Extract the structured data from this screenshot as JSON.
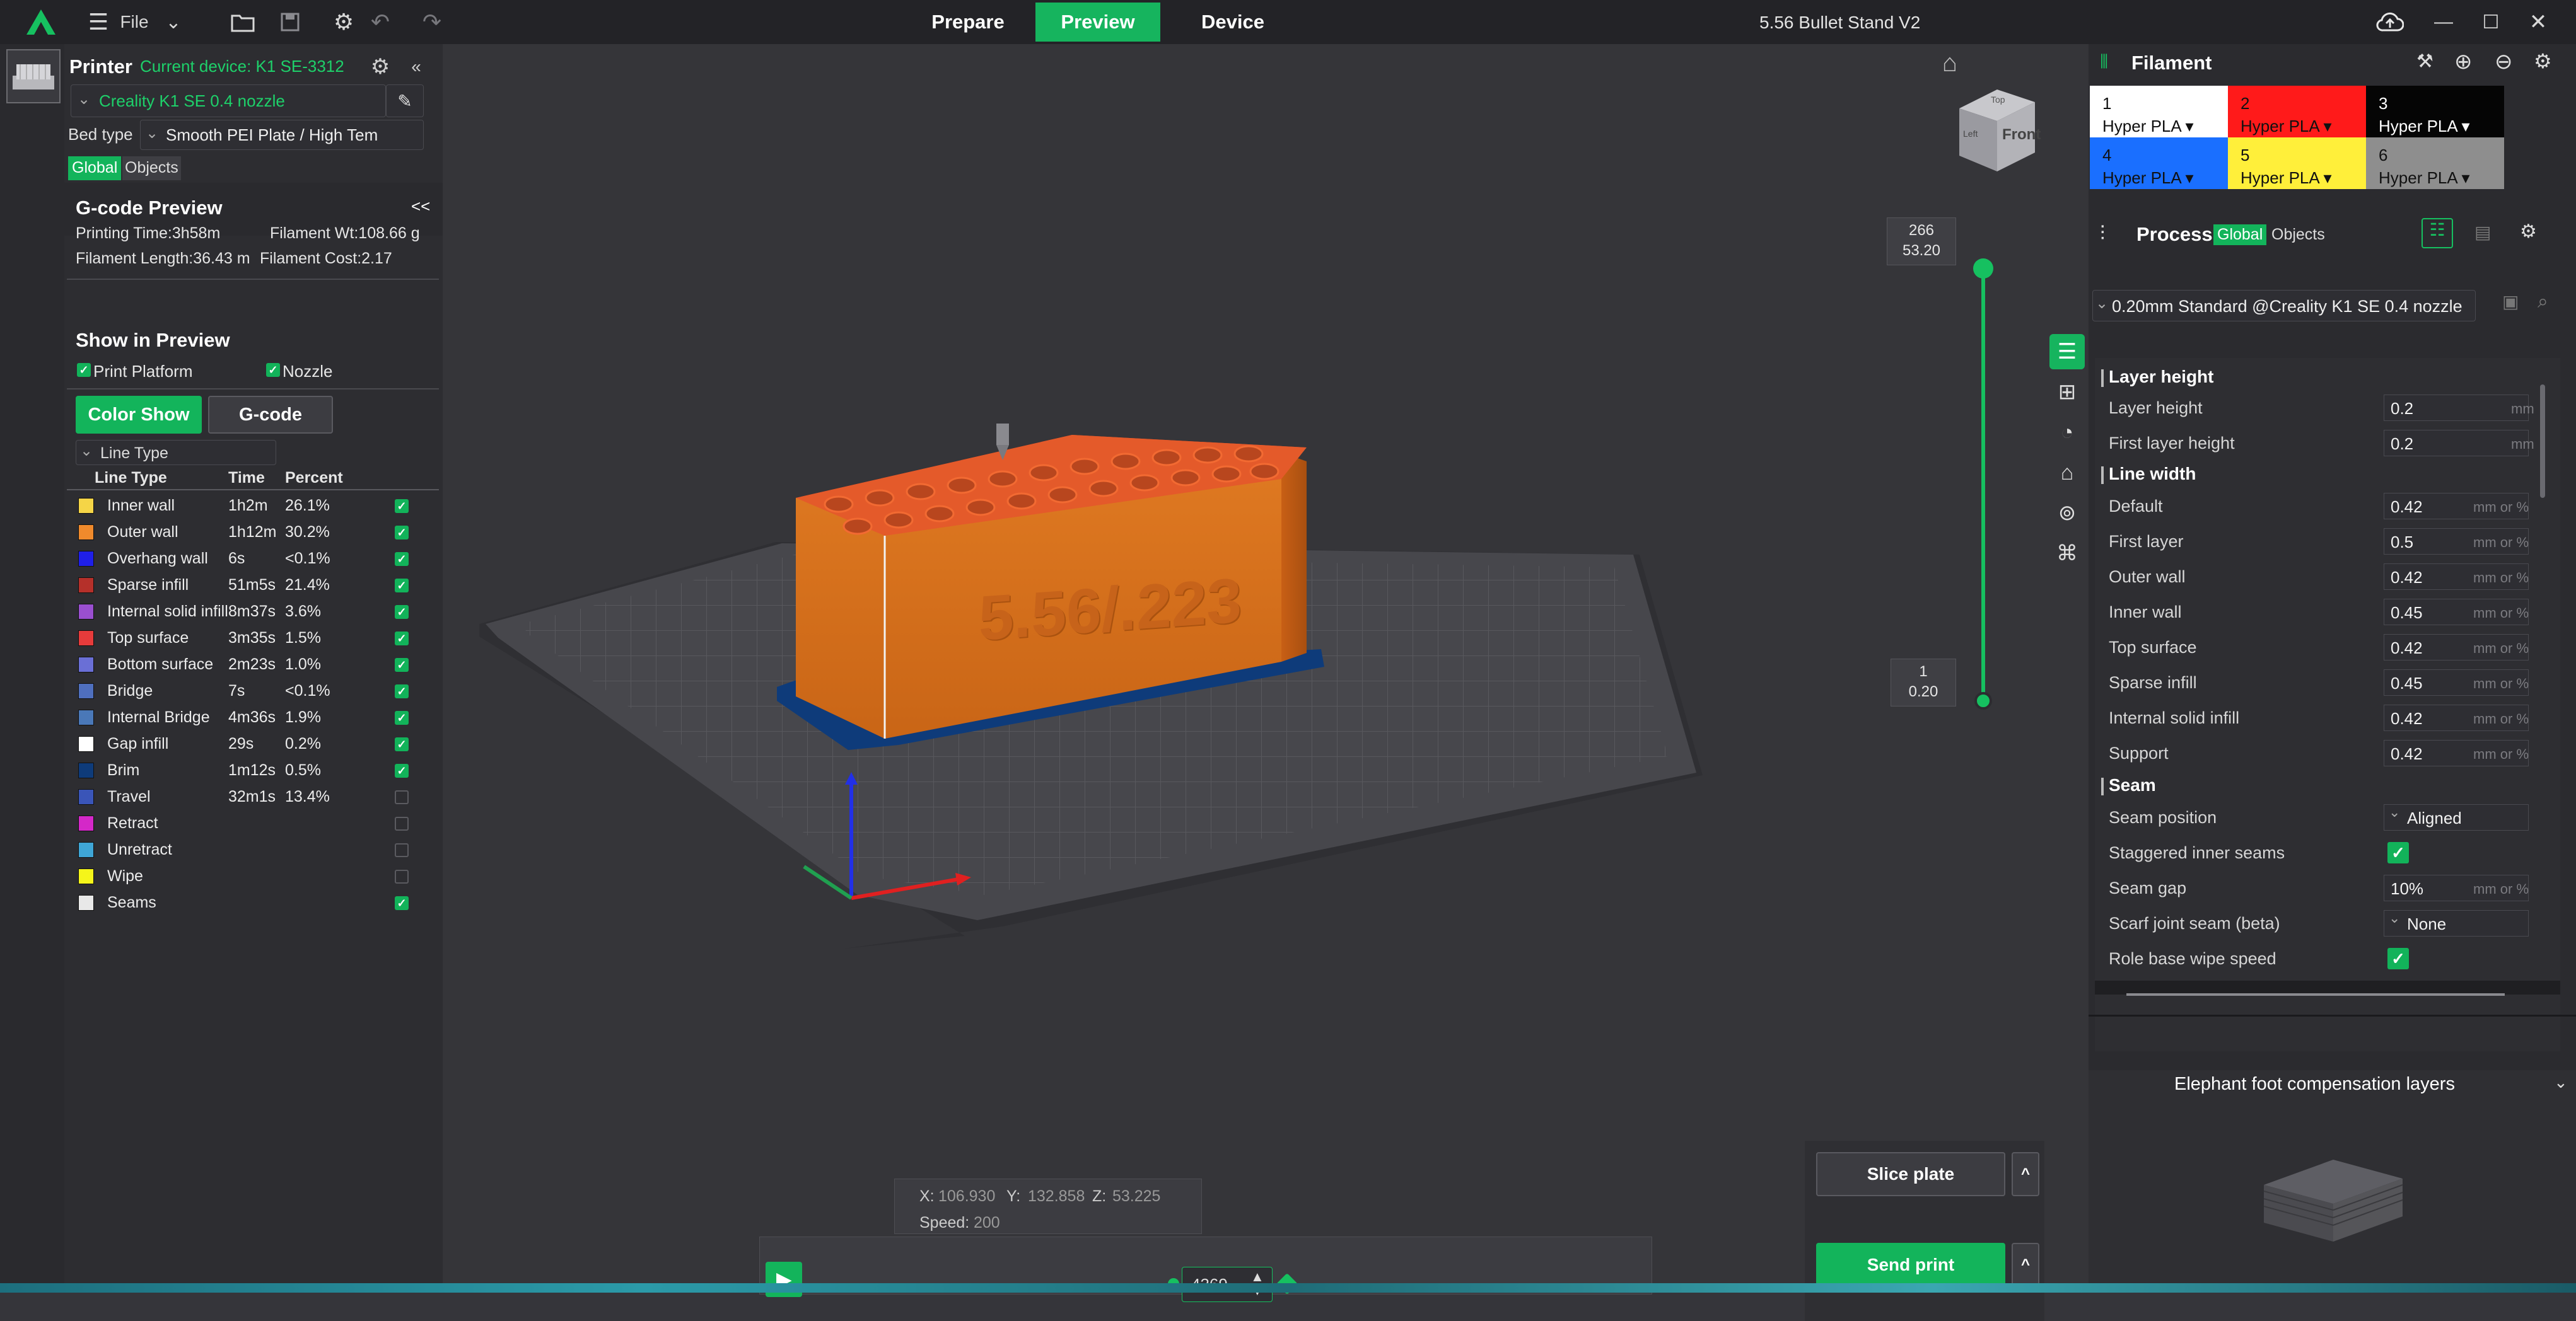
{
  "titlebar": {
    "file_label": "File",
    "tabs": [
      "Prepare",
      "Preview",
      "Device"
    ],
    "active_tab": "Preview",
    "project_title": "5.56 Bullet Stand V2"
  },
  "printer": {
    "heading": "Printer",
    "current_device": "Current device: K1 SE-3312",
    "preset": "Creality K1 SE 0.4 nozzle",
    "bed_type_label": "Bed type",
    "bed_type_value": "Smooth PEI Plate / High Tem",
    "scope_global": "Global",
    "scope_objects": "Objects"
  },
  "gcode_preview": {
    "title": "G-code Preview",
    "collapse": "<<",
    "printing_time": "Printing Time:3h58m",
    "filament_wt": "Filament Wt:108.66 g",
    "filament_length": "Filament Length:36.43 m",
    "filament_cost": "Filament Cost:2.17",
    "show_in_preview": "Show in Preview",
    "print_platform": "Print Platform",
    "nozzle": "Nozzle",
    "color_show": "Color Show",
    "gcode": "G-code",
    "line_type_dropdown": "Line Type",
    "headers": [
      "Line Type",
      "Time",
      "Percent"
    ],
    "rows": [
      {
        "name": "Inner wall",
        "time": "1h2m",
        "percent": "26.1%",
        "color": "#f5d547",
        "checked": true
      },
      {
        "name": "Outer wall",
        "time": "1h12m",
        "percent": "30.2%",
        "color": "#f08a2c",
        "checked": true
      },
      {
        "name": "Overhang wall",
        "time": "6s",
        "percent": "<0.1%",
        "color": "#1f1fe8",
        "checked": true
      },
      {
        "name": "Sparse infill",
        "time": "51m5s",
        "percent": "21.4%",
        "color": "#b5302a",
        "checked": true
      },
      {
        "name": "Internal solid infill",
        "time": "8m37s",
        "percent": "3.6%",
        "color": "#9a4fcf",
        "checked": true
      },
      {
        "name": "Top surface",
        "time": "3m35s",
        "percent": "1.5%",
        "color": "#e63b3b",
        "checked": true
      },
      {
        "name": "Bottom surface",
        "time": "2m23s",
        "percent": "1.0%",
        "color": "#6a6fd6",
        "checked": true
      },
      {
        "name": "Bridge",
        "time": "7s",
        "percent": "<0.1%",
        "color": "#4f6fbe",
        "checked": true
      },
      {
        "name": "Internal Bridge",
        "time": "4m36s",
        "percent": "1.9%",
        "color": "#4a78b8",
        "checked": true
      },
      {
        "name": "Gap infill",
        "time": "29s",
        "percent": "0.2%",
        "color": "#ffffff",
        "checked": true
      },
      {
        "name": "Brim",
        "time": "1m12s",
        "percent": "0.5%",
        "color": "#0e3b7a",
        "checked": true
      },
      {
        "name": "Travel",
        "time": "32m1s",
        "percent": "13.4%",
        "color": "#3a55b8",
        "checked": false
      },
      {
        "name": "Retract",
        "time": "",
        "percent": "",
        "color": "#d428c8",
        "checked": false
      },
      {
        "name": "Unretract",
        "time": "",
        "percent": "",
        "color": "#3fa6d6",
        "checked": false
      },
      {
        "name": "Wipe",
        "time": "",
        "percent": "",
        "color": "#f5f51a",
        "checked": false
      },
      {
        "name": "Seams",
        "time": "",
        "percent": "",
        "color": "#e8e8e8",
        "checked": true
      }
    ]
  },
  "viewport": {
    "model_text": "5.56/.223",
    "cube_label": "Front",
    "cube_top": "Top",
    "cube_left": "Left",
    "layer_top_num": "266",
    "layer_top_height": "53.20",
    "layer_bottom_num": "1",
    "layer_bottom_height": "0.20",
    "coords_x_label": "X:",
    "coords_x": "106.930",
    "coords_y_label": "Y:",
    "coords_y": "132.858",
    "coords_z_label": "Z:",
    "coords_z": "53.225",
    "speed_label": "Speed:",
    "speed": "200",
    "move_value": "4369",
    "slice_plate": "Slice plate",
    "send_print": "Send print",
    "caret": "^"
  },
  "filament": {
    "title": "Filament",
    "slots": [
      {
        "num": "1",
        "type": "Hyper PLA",
        "bg": "#ffffff",
        "fg": "#111111"
      },
      {
        "num": "2",
        "type": "Hyper PLA",
        "bg": "#ff1a1a",
        "fg": "#111111"
      },
      {
        "num": "3",
        "type": "Hyper PLA",
        "bg": "#050505",
        "fg": "#ffffff"
      },
      {
        "num": "4",
        "type": "Hyper PLA",
        "bg": "#1a6fff",
        "fg": "#111111"
      },
      {
        "num": "5",
        "type": "Hyper PLA",
        "bg": "#ffef3a",
        "fg": "#111111"
      },
      {
        "num": "6",
        "type": "Hyper PLA",
        "bg": "#8e8e8e",
        "fg": "#111111"
      }
    ]
  },
  "process": {
    "title": "Process",
    "scope_global": "Global",
    "scope_objects": "Objects",
    "preset": "0.20mm  Standard @Creality K1 SE 0.4 nozzle",
    "sections": {
      "layer_height": "Layer height",
      "line_width": "Line width",
      "seam": "Seam"
    },
    "params": {
      "layer_height": {
        "label": "Layer height",
        "value": "0.2",
        "unit": "mm"
      },
      "first_layer_height": {
        "label": "First layer height",
        "value": "0.2",
        "unit": "mm"
      },
      "default": {
        "label": "Default",
        "value": "0.42",
        "unit": "mm or %"
      },
      "first_layer": {
        "label": "First layer",
        "value": "0.5",
        "unit": "mm or %"
      },
      "outer_wall": {
        "label": "Outer wall",
        "value": "0.42",
        "unit": "mm or %"
      },
      "inner_wall": {
        "label": "Inner wall",
        "value": "0.45",
        "unit": "mm or %"
      },
      "top_surface": {
        "label": "Top surface",
        "value": "0.42",
        "unit": "mm or %"
      },
      "sparse_infill": {
        "label": "Sparse infill",
        "value": "0.45",
        "unit": "mm or %"
      },
      "internal_solid_infill": {
        "label": "Internal solid infill",
        "value": "0.42",
        "unit": "mm or %"
      },
      "support": {
        "label": "Support",
        "value": "0.42",
        "unit": "mm or %"
      },
      "seam_position": {
        "label": "Seam position",
        "value": "Aligned"
      },
      "staggered_inner_seams": {
        "label": "Staggered inner seams"
      },
      "seam_gap": {
        "label": "Seam gap",
        "value": "10%",
        "unit": "mm or %"
      },
      "scarf_joint_seam": {
        "label": "Scarf joint seam (beta)",
        "value": "None"
      },
      "role_base_wipe_speed": {
        "label": "Role base wipe speed"
      }
    }
  },
  "tip": {
    "title": "Elephant foot compensation layers"
  }
}
